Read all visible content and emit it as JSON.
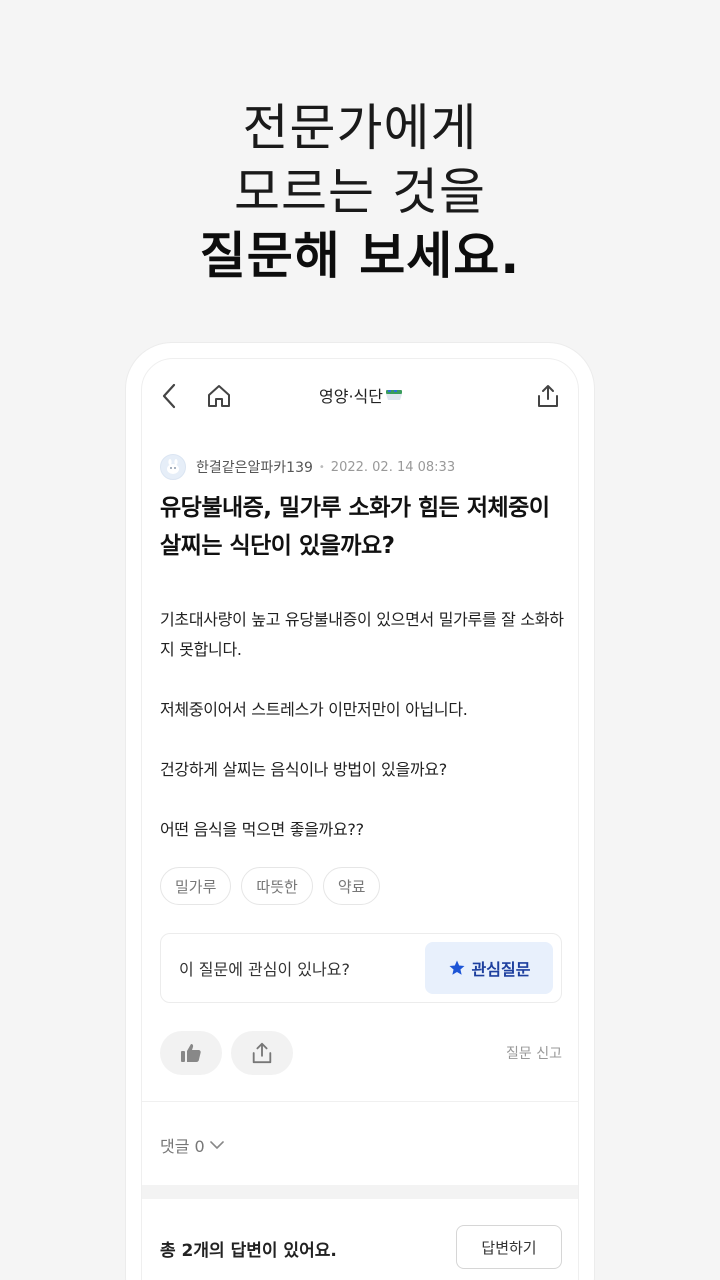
{
  "headline": {
    "line1": "전문가에게",
    "line2": "모르는 것을",
    "line3": "질문해 보세요."
  },
  "topbar": {
    "title": "영양·식단",
    "back_icon": "chevron-left-icon",
    "home_icon": "home-icon",
    "share_icon": "share-icon"
  },
  "post": {
    "author": "한결같은알파카139",
    "date": "2022. 02. 14 08:33",
    "title": "유당불내증, 밀가루 소화가 힘든 저체중이 살찌는 식단이 있을까요?",
    "body": [
      "기초대사량이 높고 유당불내증이 있으면서 밀가루를 잘 소화하지 못합니다.",
      "저체중이어서 스트레스가 이만저만이 아닙니다.",
      "건강하게 살찌는 음식이나 방법이 있을까요?",
      "어떤 음식을 먹으면 좋을까요??"
    ],
    "tags": [
      "밀가루",
      "따뜻한",
      "약료"
    ]
  },
  "interest": {
    "question": "이 질문에 관심이 있나요?",
    "button_label": "관심질문",
    "accent": "#1d3f9e"
  },
  "actions": {
    "like_icon": "thumbs-up-icon",
    "share_icon": "share-icon",
    "report_label": "질문 신고"
  },
  "comments": {
    "label": "댓글 0"
  },
  "answers": {
    "summary": "총 2개의 답변이 있어요.",
    "button_label": "답변하기"
  }
}
